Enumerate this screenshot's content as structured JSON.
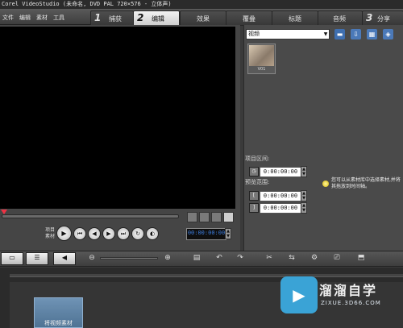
{
  "window": {
    "title": "Corel VideoStudio (未命名, DVD PAL 720×576 - 立体声)"
  },
  "menu": [
    "文件",
    "编辑",
    "素材",
    "工具"
  ],
  "steps": [
    {
      "num": "1",
      "label": "捕获"
    },
    {
      "num": "2",
      "label": "编辑"
    },
    {
      "num": "",
      "label": "效果"
    },
    {
      "num": "",
      "label": "覆叠"
    },
    {
      "num": "",
      "label": "标题"
    },
    {
      "num": "",
      "label": "音频"
    },
    {
      "num": "3",
      "label": "分享"
    }
  ],
  "player": {
    "mode_label": "项目\n素材",
    "timecode": "00:00:00:00"
  },
  "library": {
    "category": "视频",
    "thumb_label": "V01",
    "thumb_colors": [
      "#d9c9b2",
      "#8a7a6a"
    ]
  },
  "properties": {
    "project_range_label": "项目区间:",
    "project_range_value": "0:00:00:00",
    "preview_range_label": "预览范围:",
    "preview_start": "0:00:00:00",
    "preview_end": "0:00:00:00",
    "hint": "您可以从素材库中选择素材,并将其拖放到时间轴。"
  },
  "timeline": {
    "drop_hint": "将视频素材"
  },
  "watermark": {
    "title": "溜溜自学",
    "url": "ZIXUE.3D66.COM"
  },
  "colors": {
    "accent": "#3c7bd9",
    "watermark": "#3aa3d6"
  }
}
